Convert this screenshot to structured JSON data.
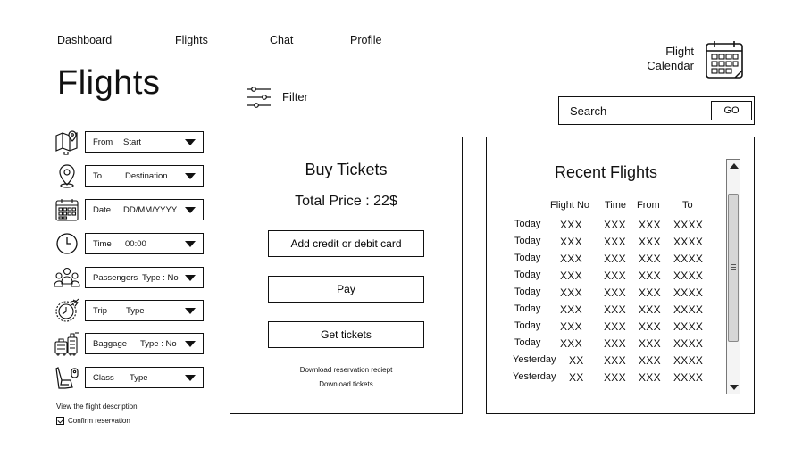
{
  "nav": {
    "dashboard": "Dashboard",
    "flights": "Flights",
    "chat": "Chat",
    "profile": "Profile"
  },
  "page_title": "Flights",
  "calendar": {
    "label_line1": "Flight",
    "label_line2": "Calendar",
    "icon": "calendar-icon"
  },
  "filter": {
    "label": "Filter",
    "icon": "sliders-icon"
  },
  "search": {
    "placeholder": "Search",
    "go_label": "GO"
  },
  "form": {
    "fields": [
      {
        "label": "From",
        "value": "Start",
        "icon": "map-pin-icon"
      },
      {
        "label": "To",
        "value": "Destination",
        "icon": "location-pin-icon"
      },
      {
        "label": "Date",
        "value": "DD/MM/YYYY",
        "icon": "calendar-icon"
      },
      {
        "label": "Time",
        "value": "00:00",
        "icon": "clock-icon"
      },
      {
        "label": "Passengers",
        "value": "Type : No",
        "icon": "people-icon"
      },
      {
        "label": "Trip",
        "value": "Type",
        "icon": "plane-clock-icon"
      },
      {
        "label": "Baggage",
        "value": "Type : No",
        "icon": "luggage-icon"
      },
      {
        "label": "Class",
        "value": "Type",
        "icon": "seat-icon"
      }
    ],
    "flight_description_link": "View the flight description",
    "confirm_reservation": "Confirm reservation"
  },
  "buy": {
    "title": "Buy Tickets",
    "total_price": "Total Price :  22$",
    "add_card_label": "Add credit or debit card",
    "pay_label": "Pay",
    "get_tickets_label": "Get tickets",
    "download_receipt": "Download reservation reciept",
    "download_tickets": "Download tickets"
  },
  "recent": {
    "title": "Recent Flights",
    "headers": [
      "Flight No",
      "Time",
      "From",
      "To"
    ],
    "rows": [
      {
        "day": "Today",
        "flight_no": "XXX",
        "time": "XXX",
        "from": "XXX",
        "to": "XXXX"
      },
      {
        "day": "Today",
        "flight_no": "XXX",
        "time": "XXX",
        "from": "XXX",
        "to": "XXXX"
      },
      {
        "day": "Today",
        "flight_no": "XXX",
        "time": "XXX",
        "from": "XXX",
        "to": "XXXX"
      },
      {
        "day": "Today",
        "flight_no": "XXX",
        "time": "XXX",
        "from": "XXX",
        "to": "XXXX"
      },
      {
        "day": "Today",
        "flight_no": "XXX",
        "time": "XXX",
        "from": "XXX",
        "to": "XXXX"
      },
      {
        "day": "Today",
        "flight_no": "XXX",
        "time": "XXX",
        "from": "XXX",
        "to": "XXXX"
      },
      {
        "day": "Today",
        "flight_no": "XXX",
        "time": "XXX",
        "from": "XXX",
        "to": "XXXX"
      },
      {
        "day": "Today",
        "flight_no": "XXX",
        "time": "XXX",
        "from": "XXX",
        "to": "XXXX"
      },
      {
        "day": "Yesterday",
        "flight_no": "XX",
        "time": "XXX",
        "from": "XXX",
        "to": "XXXX"
      },
      {
        "day": "Yesterday",
        "flight_no": "XX",
        "time": "XXX",
        "from": "XXX",
        "to": "XXXX"
      }
    ]
  }
}
